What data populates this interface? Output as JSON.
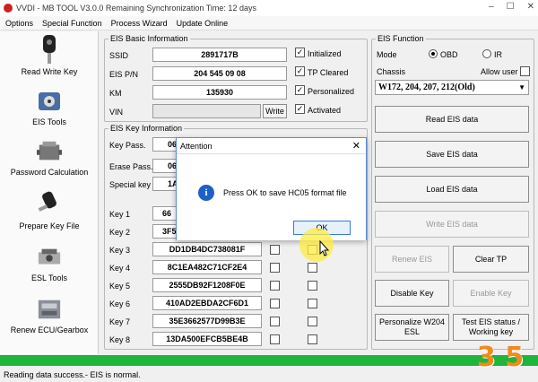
{
  "window": {
    "title": "VVDI - MB TOOL V3.0.0   Remaining Synchronization Time: 12 days",
    "min": "–",
    "max": "☐",
    "close": "✕"
  },
  "menu": [
    "Options",
    "Special Function",
    "Process Wizard",
    "Update Online"
  ],
  "sidebar": {
    "items": [
      {
        "label": "Read Write Key",
        "icon": "key-icon"
      },
      {
        "label": "EIS Tools",
        "icon": "eis-icon"
      },
      {
        "label": "Password Calculation",
        "icon": "engine-icon"
      },
      {
        "label": "Prepare Key File",
        "icon": "key-fob-icon"
      },
      {
        "label": "ESL Tools",
        "icon": "esl-icon"
      },
      {
        "label": "Renew ECU/Gearbox",
        "icon": "ecu-icon"
      }
    ]
  },
  "eis_basic": {
    "legend": "EIS Basic Information",
    "fields": [
      {
        "label": "SSID",
        "value": "2891717B"
      },
      {
        "label": "EIS P/N",
        "value": "204 545 09 08"
      },
      {
        "label": "KM",
        "value": "135930"
      },
      {
        "label": "VIN",
        "value": ""
      }
    ],
    "write_label": "Write",
    "checks": [
      {
        "label": "Initialized",
        "checked": true
      },
      {
        "label": "TP Cleared",
        "checked": true
      },
      {
        "label": "Personalized",
        "checked": true
      },
      {
        "label": "Activated",
        "checked": true
      }
    ]
  },
  "eis_key": {
    "legend": "EIS Key Information",
    "fields": [
      {
        "label": "Key Pass.",
        "value": "06"
      },
      {
        "label": "Erase Pass.",
        "value": "06"
      },
      {
        "label": "Special key",
        "value": "1A"
      }
    ],
    "keys": [
      {
        "label": "Key 1",
        "value": "66"
      },
      {
        "label": "Key 2",
        "value": "3F5"
      },
      {
        "label": "Key 3",
        "value": "DD1DB4DC738081F"
      },
      {
        "label": "Key 4",
        "value": "8C1EA482C71CF2E4"
      },
      {
        "label": "Key 5",
        "value": "2555DB92F1208F0E"
      },
      {
        "label": "Key 6",
        "value": "410AD2EBDA2CF6D1"
      },
      {
        "label": "Key 7",
        "value": "35E3662577D99B3E"
      },
      {
        "label": "Key 8",
        "value": "13DA500EFCB5BE4B"
      }
    ]
  },
  "eis_function": {
    "legend": "EIS Function",
    "mode_label": "Mode",
    "mode_obd": "OBD",
    "mode_ir": "IR",
    "chassis_label": "Chassis",
    "allow_user_label": "Allow user",
    "chassis_value": "W172, 204, 207, 212(Old)",
    "buttons": {
      "read": "Read EIS data",
      "save": "Save EIS data",
      "load": "Load EIS data",
      "write": "Write EIS data",
      "renew": "Renew EIS",
      "clear_tp": "Clear TP",
      "disable_key": "Disable Key",
      "enable_key": "Enable Key",
      "personalize_1": "Personalize W204",
      "personalize_2": "ESL",
      "test_1": "Test EIS status /",
      "test_2": "Working key"
    }
  },
  "dialog": {
    "title": "Attention",
    "message": "Press OK to save HC05 format file",
    "ok": "OK",
    "close": "✕"
  },
  "status": {
    "text": "Reading data success.- EIS is normal.",
    "progress": 1.0
  },
  "watermark": "3 5",
  "colors": {
    "progress": "#1db53a",
    "dialog_border": "#5b8fd6",
    "info": "#1f5fc8"
  }
}
